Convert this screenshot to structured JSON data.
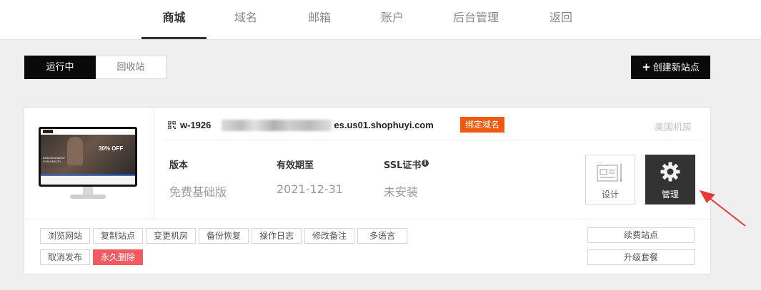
{
  "topnav": {
    "items": [
      {
        "label": "商城",
        "active": true
      },
      {
        "label": "域名",
        "active": false
      },
      {
        "label": "邮箱",
        "active": false
      },
      {
        "label": "账户",
        "active": false
      },
      {
        "label": "后台管理",
        "active": false
      },
      {
        "label": "返回",
        "active": false
      }
    ]
  },
  "status_tabs": [
    {
      "label": "运行中",
      "active": true
    },
    {
      "label": "回收站",
      "active": false
    }
  ],
  "create_button": {
    "icon": "plus-icon",
    "label": "创建新站点"
  },
  "site": {
    "domain_prefix": "w-1926",
    "domain_suffix": "es.us01.shophuyi.com",
    "bind_domain_label": "绑定域名",
    "region": "美国机房",
    "preview": {
      "offer_text": "30% OFF",
      "tagline_line1": "ENDORSEMENT",
      "tagline_line2": "FOR HEALTH"
    },
    "info": {
      "version_label": "版本",
      "version_value": "免费基础版",
      "expiry_label": "有效期至",
      "expiry_value": "2021-12-31",
      "ssl_label": "SSL证书",
      "ssl_value": "未安装"
    },
    "design_label": "设计",
    "manage_label": "管理",
    "actions_row1": [
      "浏览网站",
      "复制站点",
      "变更机房",
      "备份恢复",
      "操作日志",
      "修改备注",
      "多语言"
    ],
    "actions_row2": [
      "取消发布",
      "永久删除"
    ],
    "renew_label": "续费站点",
    "upgrade_label": "升级套餐"
  },
  "colors": {
    "accent_orange": "#f15a0e",
    "danger_red": "#f25a62",
    "dark": "#0a0a0a",
    "arrow_red": "#e53935"
  }
}
